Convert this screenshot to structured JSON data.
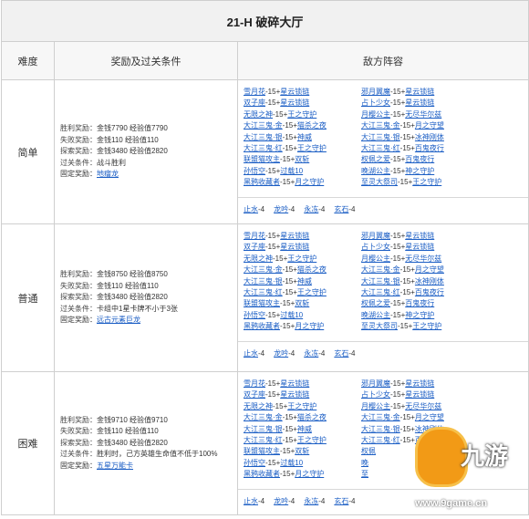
{
  "title": "21-H 破碎大厅",
  "headers": {
    "difficulty": "难度",
    "reward": "奖励及过关条件",
    "enemy": "敌方阵容"
  },
  "rows": [
    {
      "difficulty": "简单",
      "conditions": [
        {
          "key": "胜利奖励：",
          "value": "金钱7790 经验值7790"
        },
        {
          "key": "失败奖励：",
          "value": "金钱110 经验值110"
        },
        {
          "key": "探索奖励：",
          "value": "金钱3480 经验值2820"
        },
        {
          "key": "过关条件：",
          "value": "战斗胜利"
        }
      ],
      "fixed_key": "固定奖励：",
      "fixed_value": "地瘤龙",
      "left": [
        {
          "n": "雪月花",
          "l": "-15+",
          "r": "星云锁链"
        },
        {
          "n": "双子座",
          "l": "-15+",
          "r": "星云锁链"
        },
        {
          "n": "无限之神",
          "l": "-15+",
          "r": "王之守护"
        },
        {
          "n": "大江三鬼·金",
          "l": "-15+",
          "r": "猫杀之夜"
        },
        {
          "n": "大江三鬼·银",
          "l": "-15+",
          "r": "神威"
        },
        {
          "n": "大江三鬼·红",
          "l": "-15+",
          "r": "王之守护"
        },
        {
          "n": "联盟猫攻主",
          "l": "-15+",
          "r": "双斩"
        },
        {
          "n": "孙悟空",
          "l": "-15+",
          "r": "过载10"
        },
        {
          "n": "黑鸦收藏者",
          "l": "-15+",
          "r": "月之守护"
        }
      ],
      "right": [
        {
          "n": "邪月翼魔",
          "l": "-15+",
          "r": "星云锁链"
        },
        {
          "n": "占卜少女",
          "l": "-15+",
          "r": "星云锁链"
        },
        {
          "n": "月樱公主",
          "l": "-15+",
          "r": "无尽华尔兹"
        },
        {
          "n": "大江三鬼·金",
          "l": "-15+",
          "r": "月之守望"
        },
        {
          "n": "大江三鬼·银",
          "l": "-15+",
          "r": "冰神刚体"
        },
        {
          "n": "大江三鬼·红",
          "l": "-15+",
          "r": "百鬼夜行"
        },
        {
          "n": "权佩之爱",
          "l": "-15+",
          "r": "百鬼夜行"
        },
        {
          "n": "晚湖公主",
          "l": "-15+",
          "r": "神之守护"
        },
        {
          "n": "至灵大祭司",
          "l": "-15+",
          "r": "王之守护"
        }
      ],
      "subs": [
        {
          "n": "止水",
          "v": "-4"
        },
        {
          "n": "龙吟",
          "v": "-4"
        },
        {
          "n": "永冻",
          "v": "-4"
        },
        {
          "n": "玄石",
          "v": "-4"
        }
      ]
    },
    {
      "difficulty": "普通",
      "conditions": [
        {
          "key": "胜利奖励：",
          "value": "金钱8750 经验值8750"
        },
        {
          "key": "失败奖励：",
          "value": "金钱110 经验值110"
        },
        {
          "key": "探索奖励：",
          "value": "金钱3480 经验值2820"
        },
        {
          "key": "过关条件：",
          "value": "卡组中1星卡牌不小于3张"
        }
      ],
      "fixed_key": "固定奖励：",
      "fixed_value": "远古元素巨龙",
      "left": [
        {
          "n": "雪月花",
          "l": "-15+",
          "r": "星云锁链"
        },
        {
          "n": "双子座",
          "l": "-15+",
          "r": "星云锁链"
        },
        {
          "n": "无限之神",
          "l": "-15+",
          "r": "王之守护"
        },
        {
          "n": "大江三鬼·金",
          "l": "-15+",
          "r": "猫杀之夜"
        },
        {
          "n": "大江三鬼·银",
          "l": "-15+",
          "r": "神威"
        },
        {
          "n": "大江三鬼·红",
          "l": "-15+",
          "r": "王之守护"
        },
        {
          "n": "联盟猫攻主",
          "l": "-15+",
          "r": "双斩"
        },
        {
          "n": "孙悟空",
          "l": "-15+",
          "r": "过载10"
        },
        {
          "n": "黑鸦收藏者",
          "l": "-15+",
          "r": "月之守护"
        }
      ],
      "right": [
        {
          "n": "邪月翼魔",
          "l": "-15+",
          "r": "星云锁链"
        },
        {
          "n": "占卜少女",
          "l": "-15+",
          "r": "星云锁链"
        },
        {
          "n": "月樱公主",
          "l": "-15+",
          "r": "无尽华尔兹"
        },
        {
          "n": "大江三鬼·金",
          "l": "-15+",
          "r": "月之守望"
        },
        {
          "n": "大江三鬼·银",
          "l": "-15+",
          "r": "冰神刚体"
        },
        {
          "n": "大江三鬼·红",
          "l": "-15+",
          "r": "百鬼夜行"
        },
        {
          "n": "权佩之爱",
          "l": "-15+",
          "r": "百鬼夜行"
        },
        {
          "n": "晚湖公主",
          "l": "-15+",
          "r": "神之守护"
        },
        {
          "n": "至灵大祭司",
          "l": "-15+",
          "r": "王之守护"
        }
      ],
      "subs": [
        {
          "n": "止水",
          "v": "-4"
        },
        {
          "n": "龙吟",
          "v": "-4"
        },
        {
          "n": "永冻",
          "v": "-4"
        },
        {
          "n": "玄石",
          "v": "-4"
        }
      ]
    },
    {
      "difficulty": "困难",
      "conditions": [
        {
          "key": "胜利奖励：",
          "value": "金钱9710 经验值9710"
        },
        {
          "key": "失败奖励：",
          "value": "金钱110 经验值110"
        },
        {
          "key": "探索奖励：",
          "value": "金钱3480 经验值2820"
        },
        {
          "key": "过关条件：",
          "value": "胜利时，己方英雄生命值不低于100%"
        }
      ],
      "fixed_key": "固定奖励：",
      "fixed_value": "五星万能卡",
      "left": [
        {
          "n": "雪月花",
          "l": "-15+",
          "r": "星云锁链"
        },
        {
          "n": "双子座",
          "l": "-15+",
          "r": "星云锁链"
        },
        {
          "n": "无限之神",
          "l": "-15+",
          "r": "王之守护"
        },
        {
          "n": "大江三鬼·金",
          "l": "-15+",
          "r": "猫杀之夜"
        },
        {
          "n": "大江三鬼·银",
          "l": "-15+",
          "r": "神威"
        },
        {
          "n": "大江三鬼·红",
          "l": "-15+",
          "r": "王之守护"
        },
        {
          "n": "联盟猫攻主",
          "l": "-15+",
          "r": "双斩"
        },
        {
          "n": "孙悟空",
          "l": "-15+",
          "r": "过载10"
        },
        {
          "n": "黑鸦收藏者",
          "l": "-15+",
          "r": "月之守护"
        }
      ],
      "right": [
        {
          "n": "邪月翼魔",
          "l": "-15+",
          "r": "星云锁链"
        },
        {
          "n": "占卜少女",
          "l": "-15+",
          "r": "星云锁链"
        },
        {
          "n": "月樱公主",
          "l": "-15+",
          "r": "无尽华尔兹"
        },
        {
          "n": "大江三鬼·金",
          "l": "-15+",
          "r": "月之守望"
        },
        {
          "n": "大江三鬼·银",
          "l": "-15+",
          "r": "冰神刚体"
        },
        {
          "n": "大江三鬼·红",
          "l": "-15+",
          "r": "百鬼夜行"
        },
        {
          "n": "权佩",
          "l": "",
          "r": ""
        },
        {
          "n": "晚",
          "l": "",
          "r": ""
        },
        {
          "n": "至",
          "l": "",
          "r": ""
        }
      ],
      "subs": [
        {
          "n": "止水",
          "v": "-4"
        },
        {
          "n": "龙吟",
          "v": "-4"
        },
        {
          "n": "永冻",
          "v": "-4"
        },
        {
          "n": "玄石",
          "v": "-4"
        }
      ]
    }
  ],
  "watermark": {
    "brand": "九游",
    "url": "www.9game.cn",
    "color": "#f29a16"
  }
}
